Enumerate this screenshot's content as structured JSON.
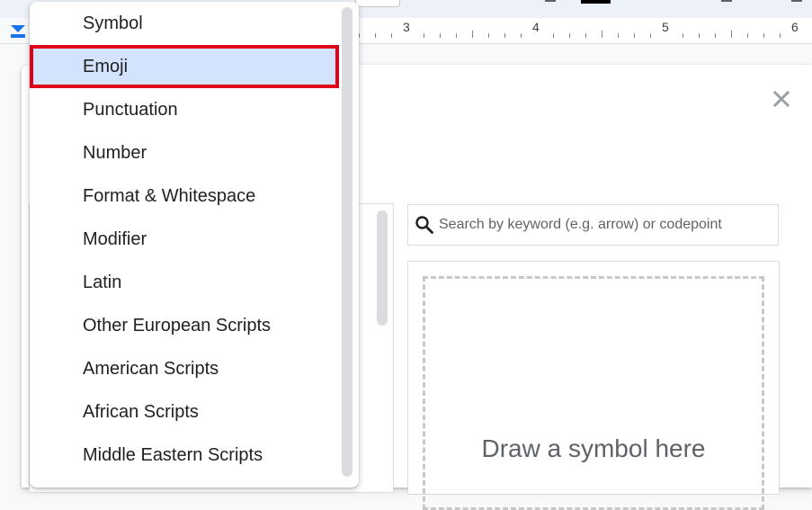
{
  "ruler": {
    "numbers": [
      "3",
      "4",
      "5",
      "6"
    ]
  },
  "dialog": {
    "close_label": "✕",
    "search": {
      "placeholder": "Search by keyword (e.g. arrow) or codepoint"
    },
    "draw_hint": "Draw a symbol here"
  },
  "category_menu": {
    "items": [
      {
        "label": "Symbol"
      },
      {
        "label": "Emoji",
        "selected": true
      },
      {
        "label": "Punctuation"
      },
      {
        "label": "Number"
      },
      {
        "label": "Format & Whitespace"
      },
      {
        "label": "Modifier"
      },
      {
        "label": "Latin"
      },
      {
        "label": "Other European Scripts"
      },
      {
        "label": "American Scripts"
      },
      {
        "label": "African Scripts"
      },
      {
        "label": "Middle Eastern Scripts"
      }
    ]
  },
  "colors": {
    "selected_bg": "#d3e3fd",
    "highlight_border": "#e0001a",
    "accent": "#1a73e8"
  },
  "icons": {
    "search": "search-icon",
    "close": "close-icon",
    "indent": "indent-marker-icon"
  }
}
